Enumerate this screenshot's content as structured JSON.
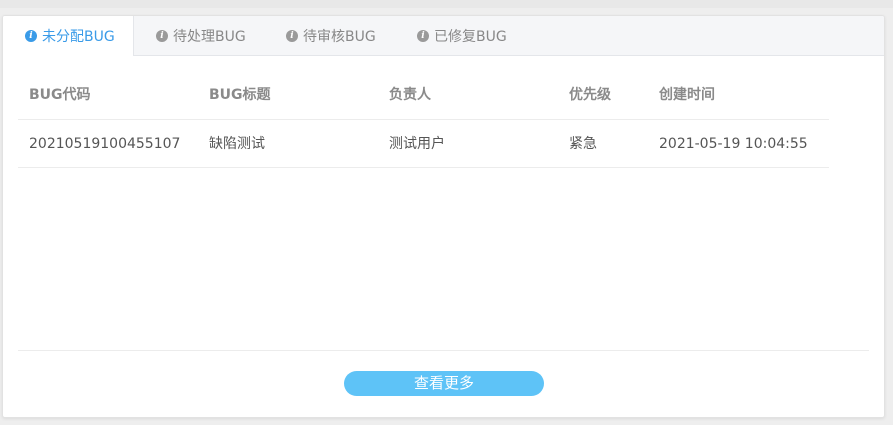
{
  "tabs": [
    {
      "label": "未分配BUG",
      "icon": "info-icon",
      "active": true
    },
    {
      "label": "待处理BUG",
      "icon": "info-icon",
      "active": false
    },
    {
      "label": "待审核BUG",
      "icon": "info-icon",
      "active": false
    },
    {
      "label": "已修复BUG",
      "icon": "info-icon",
      "active": false
    }
  ],
  "table": {
    "headers": [
      "BUG代码",
      "BUG标题",
      "负责人",
      "优先级",
      "创建时间"
    ],
    "rows": [
      [
        "20210519100455107",
        "缺陷测试",
        "测试用户",
        "紧急",
        "2021-05-19 10:04:55"
      ]
    ]
  },
  "more_button": {
    "label": "查看更多"
  },
  "colors": {
    "accent": "#3a9be8",
    "button": "#5ec3f7",
    "tab_bar_bg": "#f5f6f8"
  }
}
